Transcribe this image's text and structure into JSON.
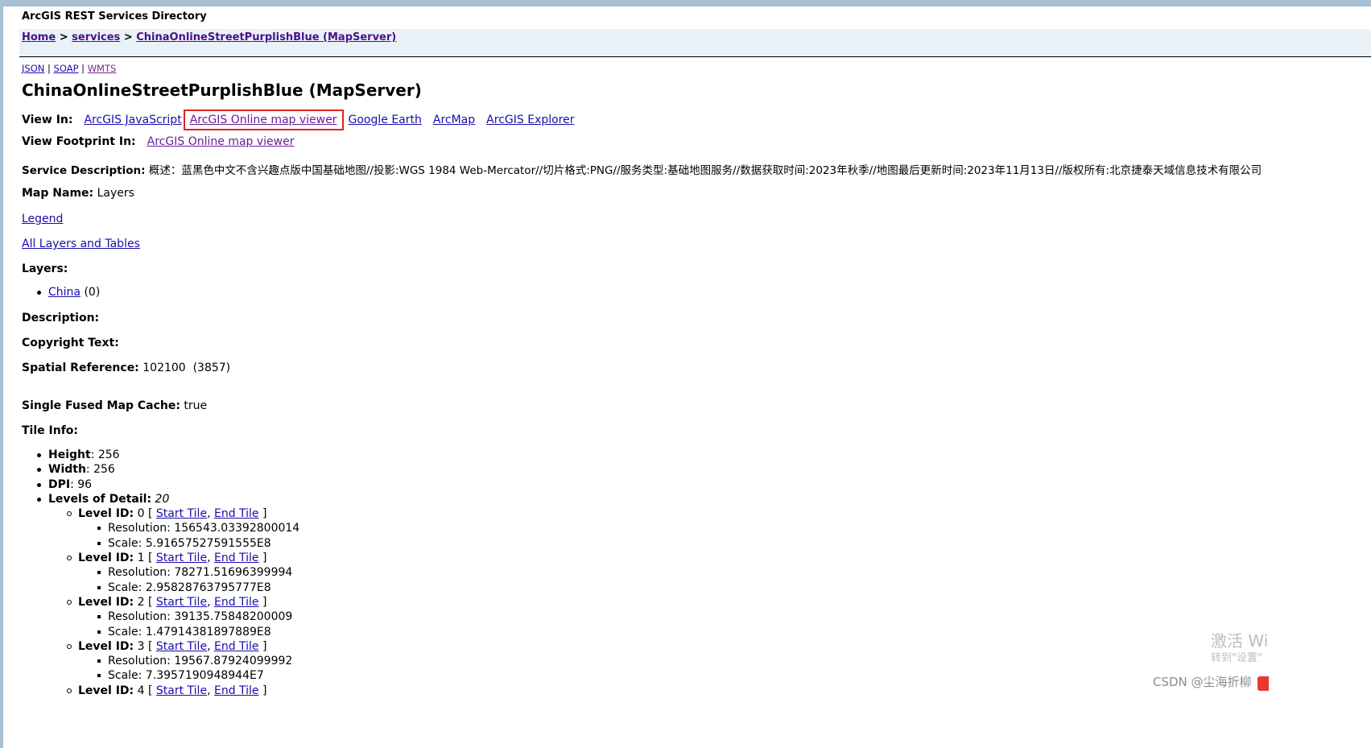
{
  "header": {
    "app_title": "ArcGIS REST Services Directory",
    "breadcrumb": {
      "home": "Home",
      "sep1": " > ",
      "services": "services",
      "sep2": " > ",
      "current": "ChinaOnlineStreetPurplishBlue (MapServer)"
    }
  },
  "formats": {
    "json": "JSON",
    "sep": " | ",
    "soap": "SOAP",
    "wmts": "WMTS"
  },
  "page_title": "ChinaOnlineStreetPurplishBlue (MapServer)",
  "view_in": {
    "label": "View In:",
    "links": [
      "ArcGIS JavaScript",
      "ArcGIS Online map viewer",
      "Google Earth",
      "ArcMap",
      "ArcGIS Explorer"
    ],
    "highlight_color": "#e02020"
  },
  "view_footprint": {
    "label": "View Footprint In:",
    "link": "ArcGIS Online map viewer"
  },
  "service_description": {
    "label": "Service Description:",
    "value": "概述：蓝黑色中文不含兴趣点版中国基础地图//投影:WGS 1984 Web-Mercator//切片格式:PNG//服务类型:基础地图服务//数据获取时间:2023年秋季//地图最后更新时间:2023年11月13日//版权所有:北京捷泰天域信息技术有限公司"
  },
  "map_name": {
    "label": "Map Name:",
    "value": "Layers"
  },
  "legend": "Legend",
  "all_layers": "All Layers and Tables",
  "layers": {
    "label": "Layers:",
    "items": [
      {
        "name": "China",
        "id": "(0)"
      }
    ]
  },
  "description": {
    "label": "Description:"
  },
  "copyright": {
    "label": "Copyright Text:"
  },
  "spatial_reference": {
    "label": "Spatial Reference:",
    "value": "102100  (3857)"
  },
  "fused_cache": {
    "label": "Single Fused Map Cache:",
    "value": "true"
  },
  "tile_info": {
    "label": "Tile Info:",
    "height": {
      "label": "Height",
      "value": ": 256"
    },
    "width": {
      "label": "Width",
      "value": ": 256"
    },
    "dpi": {
      "label": "DPI",
      "value": ": 96"
    },
    "lod": {
      "label": "Levels of Detail:",
      "count": "20"
    },
    "start_tile": "Start Tile",
    "end_tile": "End Tile",
    "levels": [
      {
        "label": "Level ID:",
        "id": "0",
        "resolution": "Resolution: 156543.03392800014",
        "scale": "Scale: 5.91657527591555E8"
      },
      {
        "label": "Level ID:",
        "id": "1",
        "resolution": "Resolution: 78271.51696399994",
        "scale": "Scale: 2.95828763795777E8"
      },
      {
        "label": "Level ID:",
        "id": "2",
        "resolution": "Resolution: 39135.75848200009",
        "scale": "Scale: 1.47914381897889E8"
      },
      {
        "label": "Level ID:",
        "id": "3",
        "resolution": "Resolution: 19567.87924099992",
        "scale": "Scale: 7.3957190948944E7"
      },
      {
        "label": "Level ID:",
        "id": "4"
      }
    ]
  },
  "watermark": {
    "line1": "激活 Wi",
    "line2": "转到\"设置\"",
    "csdn": "CSDN @尘海折柳"
  }
}
